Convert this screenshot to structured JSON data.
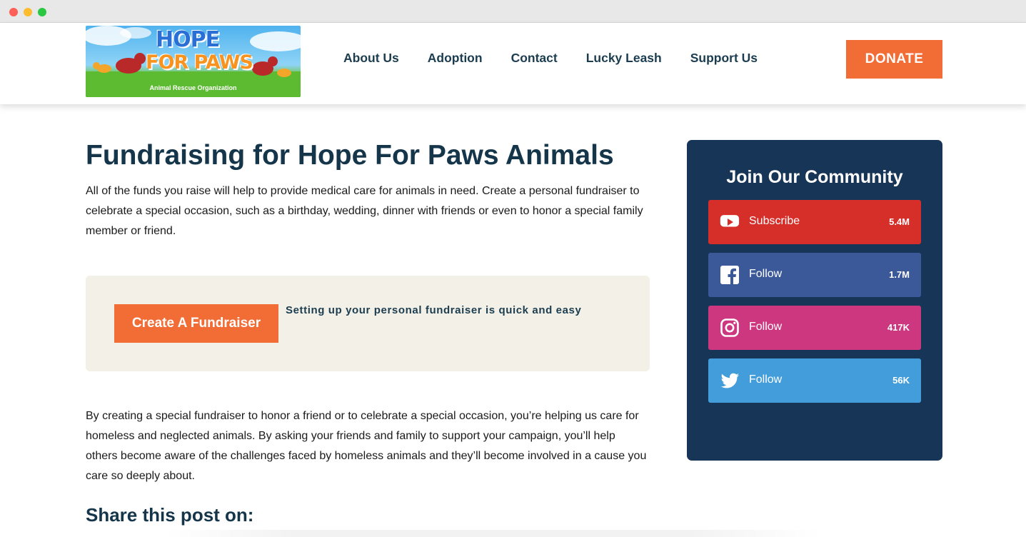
{
  "window": {
    "controls": [
      "close",
      "minimize",
      "maximize"
    ]
  },
  "header": {
    "logo": {
      "title_line1": "HOPE",
      "title_line2": "FOR PAWS",
      "tagline": "Animal Rescue Organization"
    },
    "nav": [
      {
        "label": "About Us"
      },
      {
        "label": "Adoption"
      },
      {
        "label": "Contact"
      },
      {
        "label": "Lucky Leash"
      },
      {
        "label": "Support Us"
      }
    ],
    "donate_label": "DONATE"
  },
  "main": {
    "title": "Fundraising for Hope For Paws Animals",
    "intro": "All of the funds you raise will help to provide medical care for animals in need. Create a personal fundraiser to celebrate a special occasion, such as a birthday, wedding, dinner with friends or even to honor a special family member or friend.",
    "cta": {
      "button_label": "Create A Fundraiser",
      "text": "Setting up your personal fundraiser is quick and easy"
    },
    "body": "By creating a special fundraiser to honor a friend or to celebrate a special occasion, you’re helping us care for homeless and neglected animals. By asking your friends and family to support your campaign, you’ll help others become aware of the challenges faced by homeless animals and they’ll become involved in a cause you care so deeply about.",
    "share_heading": "Share this post on:"
  },
  "community": {
    "title": "Join Our Community",
    "social": [
      {
        "network": "YouTube",
        "icon": "youtube-icon",
        "label": "Subscribe",
        "count": "5.4M",
        "color": "#d62f2a"
      },
      {
        "network": "Facebook",
        "icon": "facebook-icon",
        "label": "Follow",
        "count": "1.7M",
        "color": "#3b5998"
      },
      {
        "network": "Instagram",
        "icon": "instagram-icon",
        "label": "Follow",
        "count": "417K",
        "color": "#cc3780"
      },
      {
        "network": "Twitter",
        "icon": "twitter-icon",
        "label": "Follow",
        "count": "56K",
        "color": "#439ddb"
      }
    ]
  },
  "colors": {
    "accent_orange": "#f26c36",
    "navy": "#173557",
    "heading": "#15364a",
    "cta_background": "#f3f0e8"
  }
}
